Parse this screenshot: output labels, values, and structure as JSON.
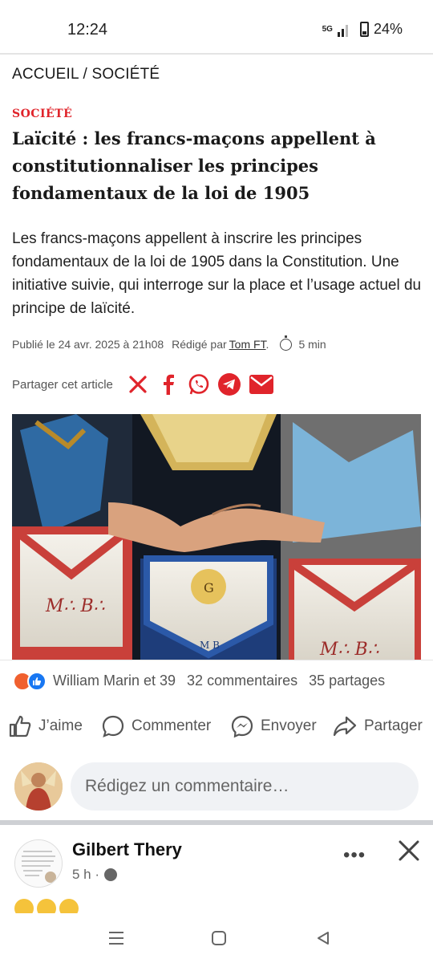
{
  "status": {
    "time": "12:24",
    "network": "5G",
    "battery": "24%"
  },
  "breadcrumb": "ACCUEIL / SOCIÉTÉ",
  "article": {
    "category": "SOCIÉTÉ",
    "title": "Laïcité : les francs-maçons appellent à constitutionnaliser les principes fondamentaux de la loi de 1905",
    "lead": "Les francs-maçons appellent à inscrire les principes fondamentaux de la loi de 1905 dans la Constitution. Une initiative suivie, qui interroge sur la place et l’usage actuel du principe de laïcité.",
    "published": "Publié le 24 avr. 2025 à 21h08",
    "written_by": "Rédigé par",
    "author": "Tom FT",
    "author_suffix": ".",
    "reading_time": "5 min",
    "share_label": "Partager cet article",
    "share_icons": [
      "x-icon",
      "facebook-icon",
      "whatsapp-icon",
      "telegram-icon",
      "email-icon"
    ],
    "image_text_left": "M∴ B∴",
    "image_text_right": "M∴ B∴",
    "image_text_center": "M B",
    "image_text_g": "G"
  },
  "facebook": {
    "reactions_names": "William Marin et 39",
    "comments_count": "32 commentaires",
    "shares_count": "35 partages",
    "actions": {
      "like": "J’aime",
      "comment": "Commenter",
      "send": "Envoyer",
      "share": "Partager"
    },
    "comment_placeholder": "Rédigez un commentaire…",
    "post": {
      "author": "Gilbert Thery",
      "time": "5 h ·"
    }
  },
  "colors": {
    "category_red": "#e0242b",
    "facebook_blue": "#1877f2",
    "comment_bg": "#f0f2f5"
  }
}
